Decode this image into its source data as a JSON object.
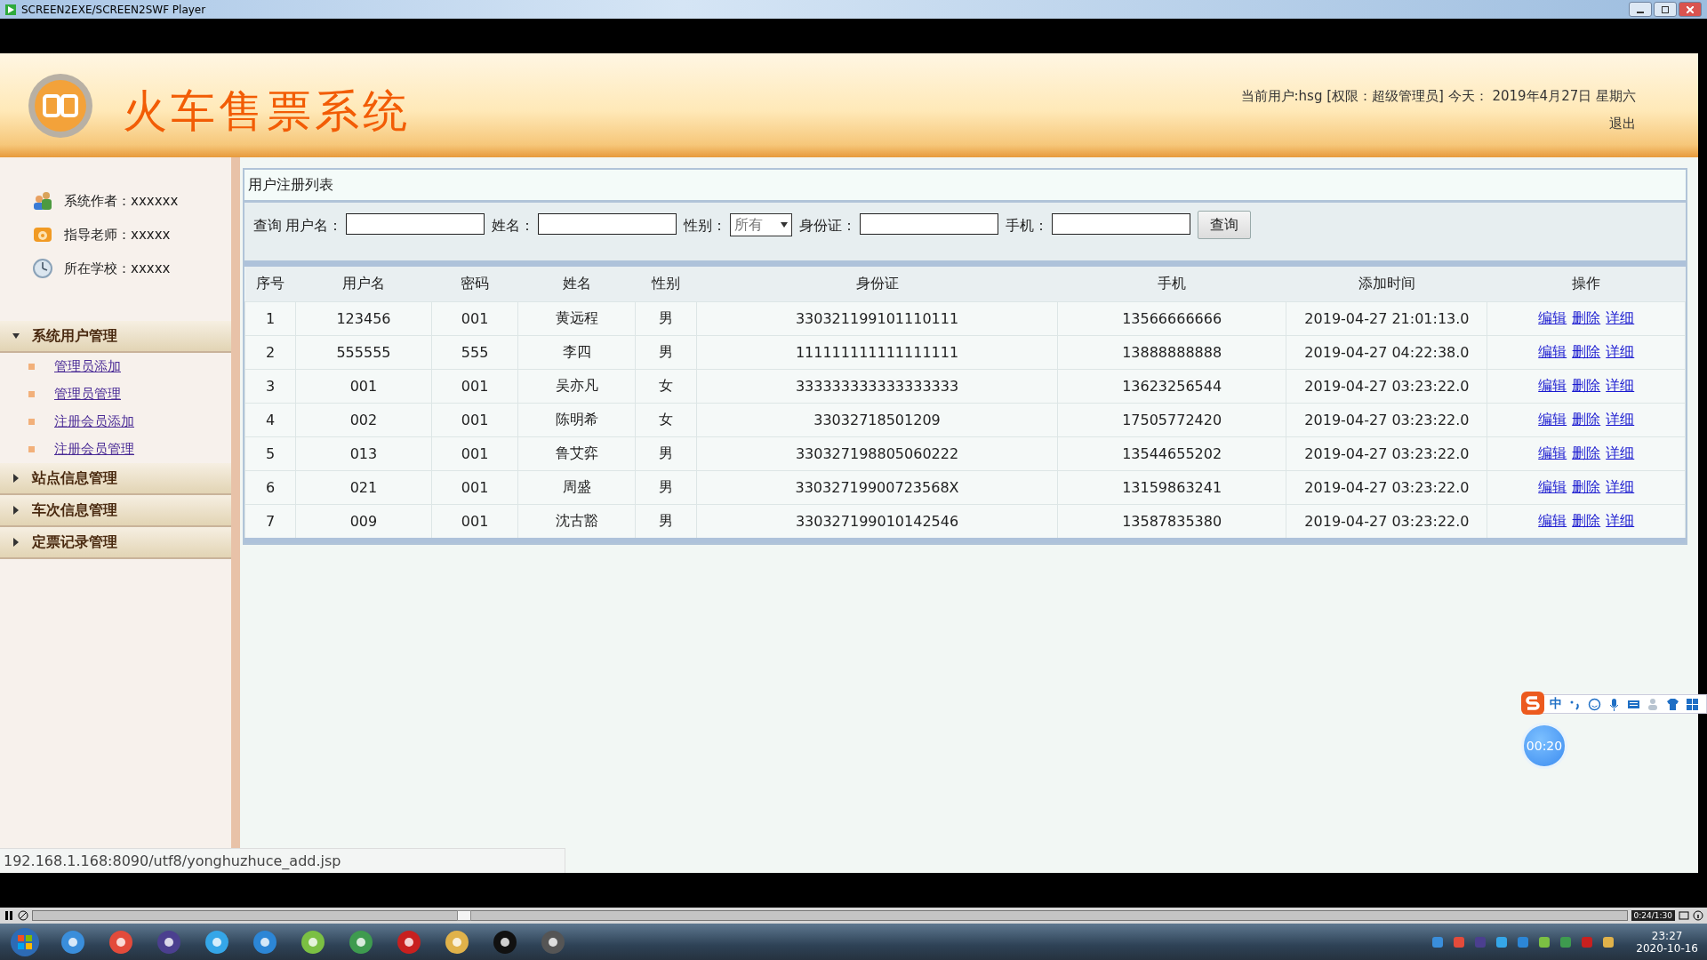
{
  "window": {
    "title": "SCREEN2EXE/SCREEN2SWF Player"
  },
  "header": {
    "title": "火车售票系统",
    "user_info": "当前用户:hsg [权限：超级管理员] 今天： 2019年4月27日 星期六",
    "logout": "退出"
  },
  "sidebar": {
    "info": [
      {
        "kind": "author",
        "text": "系统作者：xxxxxx"
      },
      {
        "kind": "teacher",
        "text": "指导老师：xxxxx"
      },
      {
        "kind": "school",
        "text": "所在学校：xxxxx"
      }
    ],
    "menu": [
      {
        "label": "系统用户管理",
        "expanded": true,
        "children": [
          {
            "label": "管理员添加"
          },
          {
            "label": "管理员管理"
          },
          {
            "label": "注册会员添加"
          },
          {
            "label": "注册会员管理"
          }
        ]
      },
      {
        "label": "站点信息管理",
        "expanded": false
      },
      {
        "label": "车次信息管理",
        "expanded": false
      },
      {
        "label": "定票记录管理",
        "expanded": false
      }
    ]
  },
  "panel": {
    "title": "用户注册列表",
    "filter": {
      "label": "查询",
      "fields": [
        {
          "kind": "text",
          "label": "用户名："
        },
        {
          "kind": "text",
          "label": "姓名："
        },
        {
          "kind": "select",
          "label": "性别：",
          "value": "所有"
        },
        {
          "kind": "text",
          "label": "身份证："
        },
        {
          "kind": "text",
          "label": "手机："
        }
      ],
      "button": "查询"
    },
    "table": {
      "columns": [
        "序号",
        "用户名",
        "密码",
        "姓名",
        "性别",
        "身份证",
        "手机",
        "添加时间",
        "操作"
      ],
      "rows": [
        {
          "cells": [
            "1",
            "123456",
            "001",
            "黄远程",
            "男",
            "330321199101110111",
            "13566666666",
            "2019-04-27 21:01:13.0"
          ],
          "actions": [
            "编辑",
            "删除",
            "详细"
          ]
        },
        {
          "cells": [
            "2",
            "555555",
            "555",
            "李四",
            "男",
            "111111111111111111",
            "13888888888",
            "2019-04-27 04:22:38.0"
          ],
          "actions": [
            "编辑",
            "删除",
            "详细"
          ]
        },
        {
          "cells": [
            "3",
            "001",
            "001",
            "吴亦凡",
            "女",
            "333333333333333333",
            "13623256544",
            "2019-04-27 03:23:22.0"
          ],
          "actions": [
            "编辑",
            "删除",
            "详细"
          ]
        },
        {
          "cells": [
            "4",
            "002",
            "001",
            "陈明希",
            "女",
            "33032718501209",
            "17505772420",
            "2019-04-27 03:23:22.0"
          ],
          "actions": [
            "编辑",
            "删除",
            "详细"
          ]
        },
        {
          "cells": [
            "5",
            "013",
            "001",
            "鲁艾弈",
            "男",
            "330327198805060222",
            "13544655202",
            "2019-04-27 03:23:22.0"
          ],
          "actions": [
            "编辑",
            "删除",
            "详细"
          ]
        },
        {
          "cells": [
            "6",
            "021",
            "001",
            "周盛",
            "男",
            "33032719900723568X",
            "13159863241",
            "2019-04-27 03:23:22.0"
          ],
          "actions": [
            "编辑",
            "删除",
            "详细"
          ]
        },
        {
          "cells": [
            "7",
            "009",
            "001",
            "沈古豁",
            "男",
            "330327199010142546",
            "13587835380",
            "2019-04-27 03:23:22.0"
          ],
          "actions": [
            "编辑",
            "删除",
            "详细"
          ]
        }
      ]
    }
  },
  "status_bar": {
    "url": "192.168.1.168:8090/utf8/yonghuzhuce_add.jsp"
  },
  "player": {
    "level": 0.27,
    "time": "0:24/1:30"
  },
  "ime": {
    "mode": "中"
  },
  "timer": "00:20",
  "taskbar": {
    "time": "23:27",
    "date": "2020-10-16"
  }
}
